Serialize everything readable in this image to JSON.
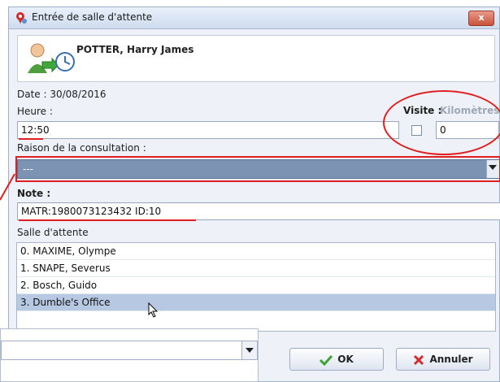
{
  "window": {
    "title": "Entrée de salle d'attente",
    "close_glyph": "x"
  },
  "patient": {
    "name": "POTTER, Harry James"
  },
  "form": {
    "date_text": "Date : 30/08/2016",
    "time_label": "Heure :",
    "time_value": "12:50",
    "visit_label": "Visite :",
    "km_label": "Kilomètres",
    "km_value": "0",
    "reason_label": "Raison de la consultation :",
    "reason_value": "---",
    "note_label": "Note :",
    "note_value": "MATR:1980073123432 ID:10",
    "waiting_label": "Salle d'attente"
  },
  "waiting_rooms": [
    {
      "label": "0. MAXIME, Olympe",
      "selected": false
    },
    {
      "label": "1. SNAPE, Severus",
      "selected": false
    },
    {
      "label": "2. Bosch, Guido",
      "selected": false
    },
    {
      "label": "3. Dumble's Office",
      "selected": true
    }
  ],
  "buttons": {
    "ok_label": "OK",
    "cancel_label": "Annuler"
  },
  "colors": {
    "annotation_red": "#e02020",
    "selection_blue": "#b7c8e2",
    "combo_blue": "#7c93b4"
  }
}
